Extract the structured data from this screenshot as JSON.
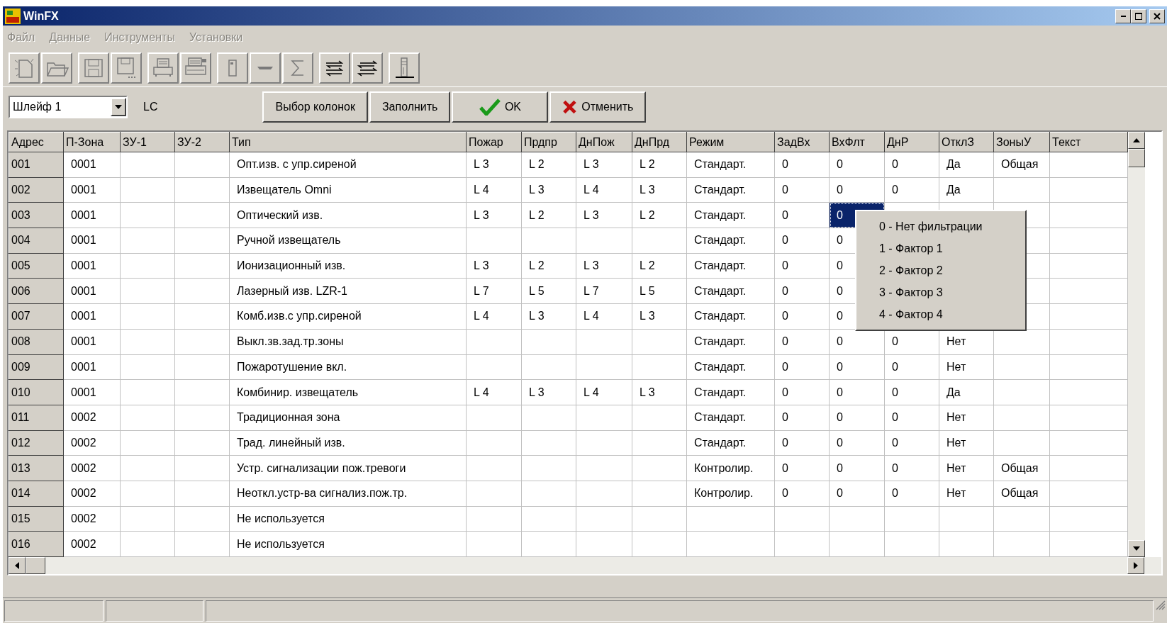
{
  "window": {
    "title": "WinFX"
  },
  "menu": [
    {
      "label": "Файл",
      "disabled": true
    },
    {
      "label": "Данные",
      "disabled": true
    },
    {
      "label": "Инструменты",
      "disabled": true
    },
    {
      "label": "Установки",
      "disabled": true
    }
  ],
  "loop_select": {
    "value": "Шлейф 1"
  },
  "loop_label": "LC",
  "buttons": [
    {
      "label": "Выбор колонок",
      "kind": "plain"
    },
    {
      "label": "Заполнить",
      "kind": "plain"
    },
    {
      "label": "OK",
      "kind": "ok"
    },
    {
      "label": "Отменить",
      "kind": "cancel"
    }
  ],
  "table": {
    "columns": [
      "Адрес",
      "П-Зона",
      "ЗУ-1",
      "ЗУ-2",
      "Тип",
      "Пожар",
      "Прдпр",
      "ДнПож",
      "ДнПрд",
      "Режим",
      "ЗадВх",
      "ВхФлт",
      "ДнР",
      "ОтклЗ",
      "ЗоныУ",
      "Текст"
    ],
    "rows": [
      {
        "cells": [
          "001",
          "0001",
          "",
          "",
          "Опт.изв. с упр.сиреной",
          "L 3",
          "L 2",
          "L 3",
          "L 2",
          "Стандарт.",
          "0",
          "0",
          "0",
          "Да",
          "Общая",
          ""
        ],
        "selected_cells": [
          false,
          false,
          false,
          false,
          false,
          false,
          false,
          false,
          false,
          false,
          false,
          false,
          false,
          false,
          false,
          false
        ]
      },
      {
        "cells": [
          "002",
          "0001",
          "",
          "",
          "Извещатель Omni",
          "L 4",
          "L 3",
          "L 4",
          "L 3",
          "Стандарт.",
          "0",
          "0",
          "0",
          "Да",
          "",
          ""
        ],
        "selected_cells": [
          false,
          false,
          false,
          false,
          false,
          false,
          false,
          false,
          false,
          false,
          false,
          false,
          false,
          false,
          false,
          false
        ]
      },
      {
        "cells": [
          "003",
          "0001",
          "",
          "",
          "Оптический изв.",
          "L 3",
          "L 2",
          "L 3",
          "L 2",
          "Стандарт.",
          "0",
          "0",
          "",
          "",
          "",
          ""
        ],
        "selected_cells": [
          false,
          false,
          false,
          false,
          false,
          false,
          false,
          false,
          false,
          false,
          false,
          true,
          false,
          false,
          false,
          false
        ]
      },
      {
        "cells": [
          "004",
          "0001",
          "",
          "",
          "Ручной извещатель",
          "",
          "",
          "",
          "",
          "Стандарт.",
          "0",
          "0",
          "",
          "",
          "",
          ""
        ],
        "selected_cells": [
          false,
          false,
          false,
          false,
          false,
          false,
          false,
          false,
          false,
          false,
          false,
          false,
          null,
          null,
          false,
          false
        ]
      },
      {
        "cells": [
          "005",
          "0001",
          "",
          "",
          "Ионизационный изв.",
          "L 3",
          "L 2",
          "L 3",
          "L 2",
          "Стандарт.",
          "0",
          "0",
          "",
          "",
          "",
          ""
        ],
        "selected_cells": [
          false,
          false,
          false,
          false,
          false,
          false,
          false,
          false,
          false,
          false,
          false,
          false,
          null,
          null,
          false,
          false
        ]
      },
      {
        "cells": [
          "006",
          "0001",
          "",
          "",
          "Лазерный изв. LZR-1",
          "L 7",
          "L 5",
          "L 7",
          "L 5",
          "Стандарт.",
          "0",
          "0",
          "",
          "",
          "",
          ""
        ],
        "selected_cells": [
          false,
          false,
          false,
          false,
          false,
          false,
          false,
          false,
          false,
          false,
          false,
          false,
          null,
          null,
          false,
          false
        ]
      },
      {
        "cells": [
          "007",
          "0001",
          "",
          "",
          "Комб.изв.с упр.сиреной",
          "L 4",
          "L 3",
          "L 4",
          "L 3",
          "Стандарт.",
          "0",
          "0",
          "",
          "",
          "",
          ""
        ],
        "selected_cells": [
          false,
          false,
          false,
          false,
          false,
          false,
          false,
          false,
          false,
          false,
          false,
          false,
          null,
          null,
          false,
          false
        ]
      },
      {
        "cells": [
          "008",
          "0001",
          "",
          "",
          "Выкл.зв.зад.тр.зоны",
          "",
          "",
          "",
          "",
          "Стандарт.",
          "0",
          "0",
          "0",
          "Нет",
          "",
          ""
        ],
        "selected_cells": [
          false,
          false,
          false,
          false,
          false,
          false,
          false,
          false,
          false,
          false,
          false,
          false,
          false,
          false,
          false,
          false
        ]
      },
      {
        "cells": [
          "009",
          "0001",
          "",
          "",
          "Пожаротушение вкл.",
          "",
          "",
          "",
          "",
          "Стандарт.",
          "0",
          "0",
          "0",
          "Нет",
          "",
          ""
        ],
        "selected_cells": [
          false,
          false,
          false,
          false,
          false,
          false,
          false,
          false,
          false,
          false,
          false,
          false,
          false,
          false,
          false,
          false
        ]
      },
      {
        "cells": [
          "010",
          "0001",
          "",
          "",
          "Комбинир. извещатель",
          "L 4",
          "L 3",
          "L 4",
          "L 3",
          "Стандарт.",
          "0",
          "0",
          "0",
          "Да",
          "",
          ""
        ],
        "selected_cells": [
          false,
          false,
          false,
          false,
          false,
          false,
          false,
          false,
          false,
          false,
          false,
          false,
          false,
          false,
          false,
          false
        ]
      },
      {
        "cells": [
          "011",
          "0002",
          "",
          "",
          "Традиционная зона",
          "",
          "",
          "",
          "",
          "Стандарт.",
          "0",
          "0",
          "0",
          "Нет",
          "",
          ""
        ],
        "selected_cells": [
          false,
          false,
          false,
          false,
          false,
          false,
          false,
          false,
          false,
          false,
          false,
          false,
          false,
          false,
          false,
          false
        ]
      },
      {
        "cells": [
          "012",
          "0002",
          "",
          "",
          "Трад. линейный изв.",
          "",
          "",
          "",
          "",
          "Стандарт.",
          "0",
          "0",
          "0",
          "Нет",
          "",
          ""
        ],
        "selected_cells": [
          false,
          false,
          false,
          false,
          false,
          false,
          false,
          false,
          false,
          false,
          false,
          false,
          false,
          false,
          false,
          false
        ]
      },
      {
        "cells": [
          "013",
          "0002",
          "",
          "",
          "Устр. сигнализации пож.тревоги",
          "",
          "",
          "",
          "",
          "Контролир.",
          "0",
          "0",
          "0",
          "Нет",
          "Общая",
          ""
        ],
        "selected_cells": [
          false,
          false,
          false,
          false,
          false,
          false,
          false,
          false,
          false,
          false,
          false,
          false,
          false,
          false,
          false,
          false
        ]
      },
      {
        "cells": [
          "014",
          "0002",
          "",
          "",
          "Неоткл.устр-ва сигнализ.пож.тр.",
          "",
          "",
          "",
          "",
          "Контролир.",
          "0",
          "0",
          "0",
          "Нет",
          "Общая",
          ""
        ],
        "selected_cells": [
          false,
          false,
          false,
          false,
          false,
          false,
          false,
          false,
          false,
          false,
          false,
          false,
          false,
          false,
          false,
          false
        ]
      },
      {
        "cells": [
          "015",
          "0002",
          "",
          "",
          "Не используется",
          "",
          "",
          "",
          "",
          "",
          "",
          "",
          "",
          "",
          "",
          ""
        ],
        "selected_cells": [
          false,
          false,
          false,
          false,
          false,
          false,
          false,
          false,
          false,
          false,
          false,
          false,
          false,
          false,
          false,
          false
        ]
      },
      {
        "cells": [
          "016",
          "0002",
          "",
          "",
          "Не используется",
          "",
          "",
          "",
          "",
          "",
          "",
          "",
          "",
          "",
          "",
          ""
        ],
        "selected_cells": [
          false,
          false,
          false,
          false,
          false,
          false,
          false,
          false,
          false,
          false,
          false,
          false,
          false,
          false,
          false,
          false
        ]
      }
    ]
  },
  "dropdown_menu": {
    "items": [
      "0 - Нет фильтрации",
      "1 - Фактор 1",
      "2 - Фактор 2",
      "3 - Фактор 3",
      "4 - Фактор 4"
    ]
  }
}
